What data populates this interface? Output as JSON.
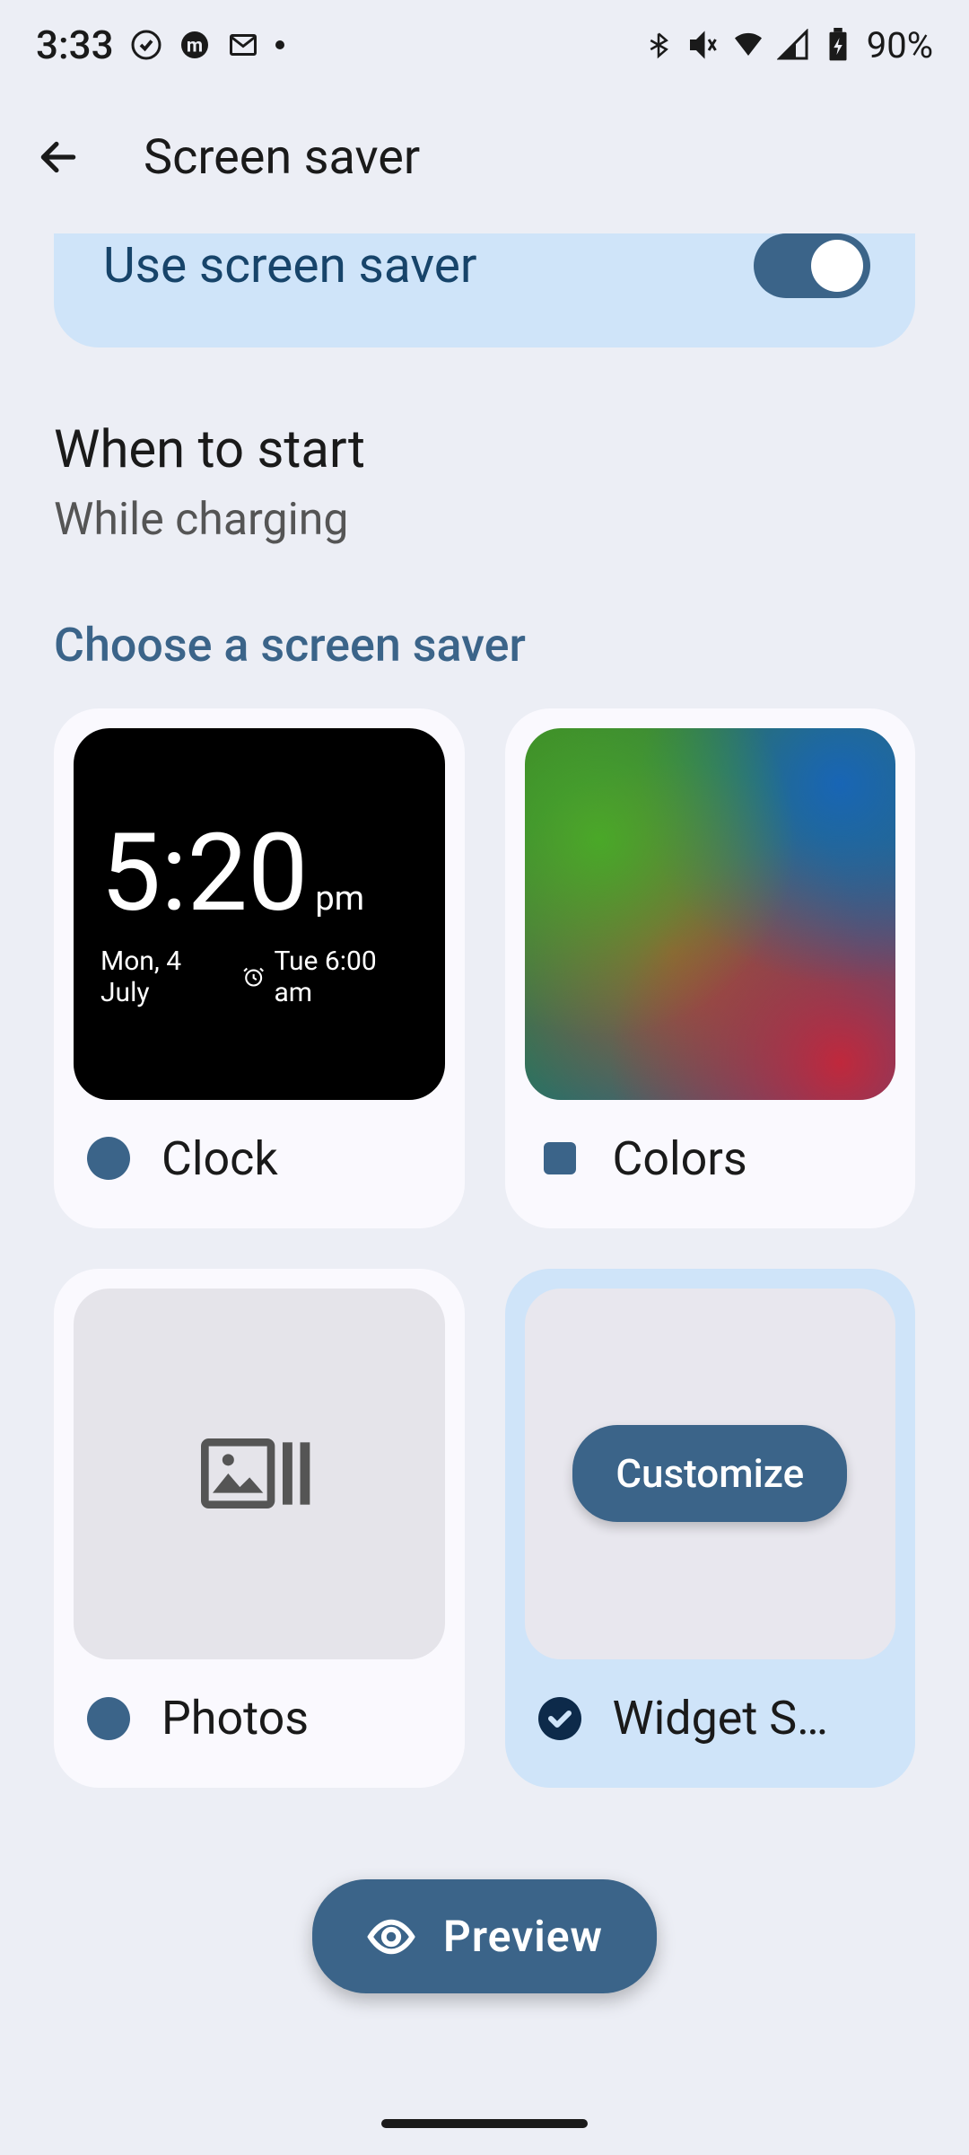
{
  "status": {
    "time": "3:33",
    "battery_pct": "90%"
  },
  "app_bar": {
    "title": "Screen saver"
  },
  "use_saver": {
    "label": "Use screen saver",
    "enabled": true
  },
  "when_to_start": {
    "title": "When to start",
    "value": "While charging"
  },
  "section_header": "Choose a screen saver",
  "savers": [
    {
      "id": "clock",
      "label": "Clock",
      "selected": false,
      "radio_shape": "circle",
      "preview": {
        "time": "5:20",
        "ampm": "pm",
        "date": "Mon, 4 July",
        "alarm": "Tue 6:00 am"
      }
    },
    {
      "id": "colors",
      "label": "Colors",
      "selected": false,
      "radio_shape": "square"
    },
    {
      "id": "photos",
      "label": "Photos",
      "selected": false,
      "radio_shape": "circle"
    },
    {
      "id": "widget",
      "label": "Widget S…",
      "selected": true,
      "radio_shape": "check",
      "customize_label": "Customize"
    }
  ],
  "preview_button": "Preview",
  "colors": {
    "accent": "#3b6489",
    "highlight_bg": "#cfe4f9",
    "page_bg": "#eceef5"
  }
}
